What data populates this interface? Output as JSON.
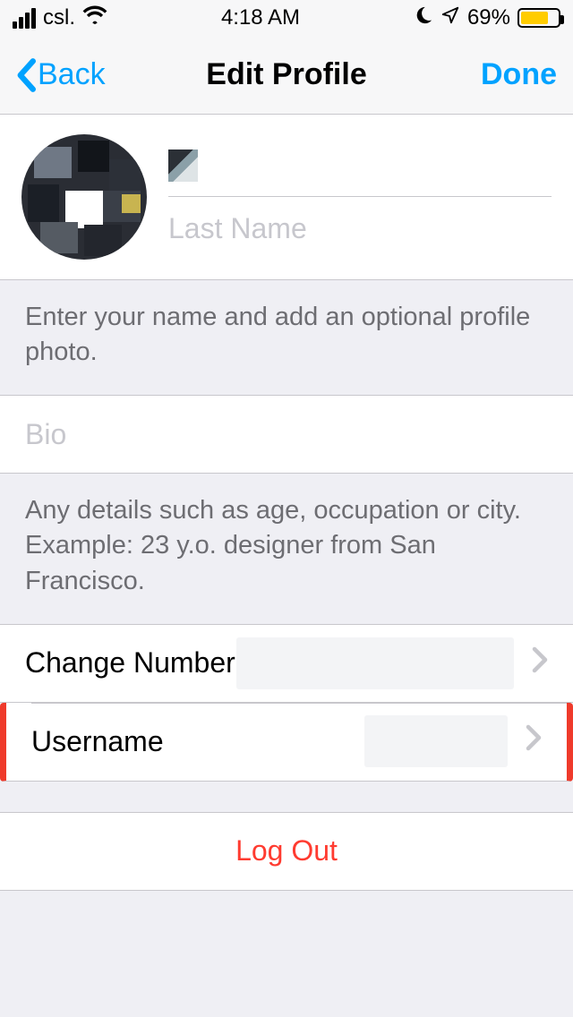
{
  "status": {
    "carrier": "csl.",
    "time": "4:18 AM",
    "battery_pct": "69%",
    "battery_fill_pct": 69
  },
  "nav": {
    "back": "Back",
    "title": "Edit Profile",
    "done": "Done"
  },
  "name_fields": {
    "first_value": "",
    "last_placeholder": "Last Name"
  },
  "help": {
    "name": "Enter your name and add an optional profile photo.",
    "bio": "Any details such as age, occupation or city. Example: 23 y.o. designer from San Francisco."
  },
  "bio": {
    "placeholder": "Bio"
  },
  "rows": {
    "change_number": "Change Number",
    "username": "Username"
  },
  "logout": "Log Out"
}
